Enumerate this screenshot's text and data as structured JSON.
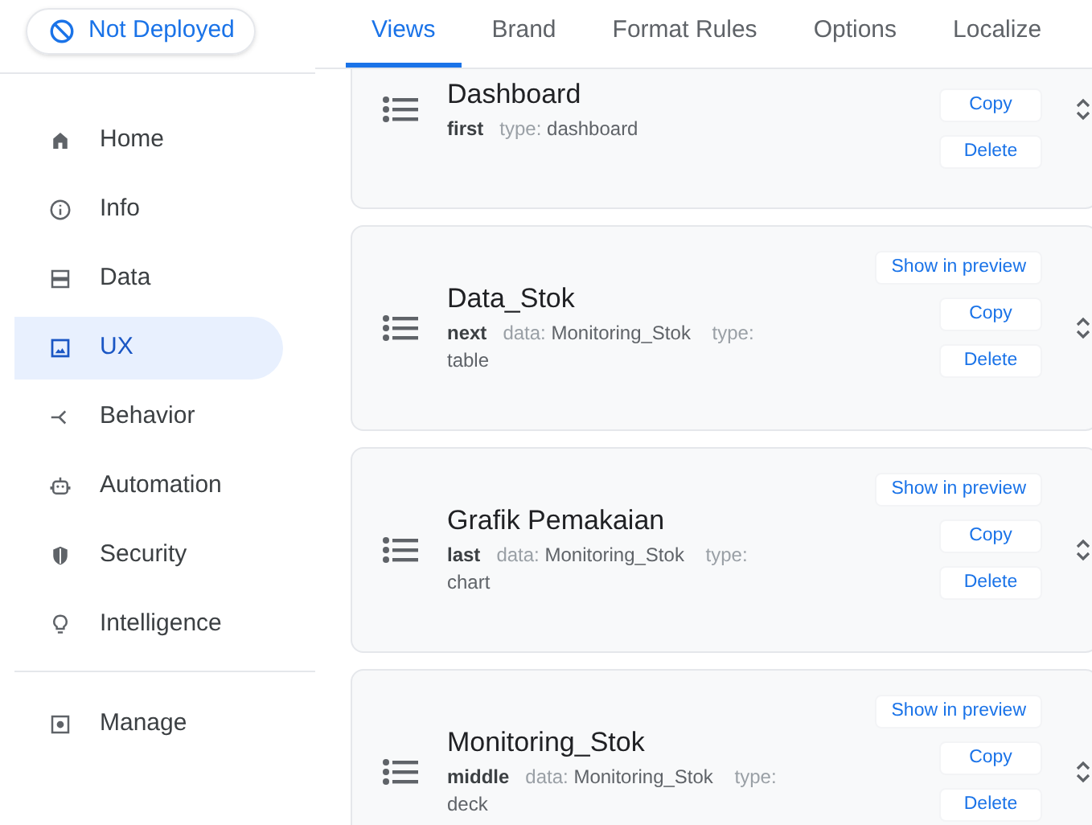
{
  "status": {
    "label": "Not Deployed"
  },
  "sidebar": {
    "items": [
      {
        "label": "Home",
        "selected": false
      },
      {
        "label": "Info",
        "selected": false
      },
      {
        "label": "Data",
        "selected": false
      },
      {
        "label": "UX",
        "selected": true
      },
      {
        "label": "Behavior",
        "selected": false
      },
      {
        "label": "Automation",
        "selected": false
      },
      {
        "label": "Security",
        "selected": false
      },
      {
        "label": "Intelligence",
        "selected": false
      }
    ],
    "footer_items": [
      {
        "label": "Manage",
        "selected": false
      }
    ]
  },
  "tabs": [
    {
      "label": "Views",
      "selected": true
    },
    {
      "label": "Brand",
      "selected": false
    },
    {
      "label": "Format Rules",
      "selected": false
    },
    {
      "label": "Options",
      "selected": false
    },
    {
      "label": "Localize",
      "selected": false
    }
  ],
  "views": [
    {
      "title": "Dashboard",
      "position": "first",
      "type_label": "type:",
      "type": "dashboard",
      "buttons": [
        "Copy",
        "Delete"
      ]
    },
    {
      "title": "Data_Stok",
      "position": "next",
      "data_label": "data:",
      "data": "Monitoring_Stok",
      "type_label": "type:",
      "type": "table",
      "buttons": [
        "Show in preview",
        "Copy",
        "Delete"
      ]
    },
    {
      "title": "Grafik Pemakaian",
      "position": "last",
      "data_label": "data:",
      "data": "Monitoring_Stok",
      "type_label": "type:",
      "type": "chart",
      "buttons": [
        "Show in preview",
        "Copy",
        "Delete"
      ]
    },
    {
      "title": "Monitoring_Stok",
      "position": "middle",
      "data_label": "data:",
      "data": "Monitoring_Stok",
      "type_label": "type:",
      "type": "deck",
      "buttons": [
        "Show in preview",
        "Copy",
        "Delete"
      ]
    }
  ]
}
